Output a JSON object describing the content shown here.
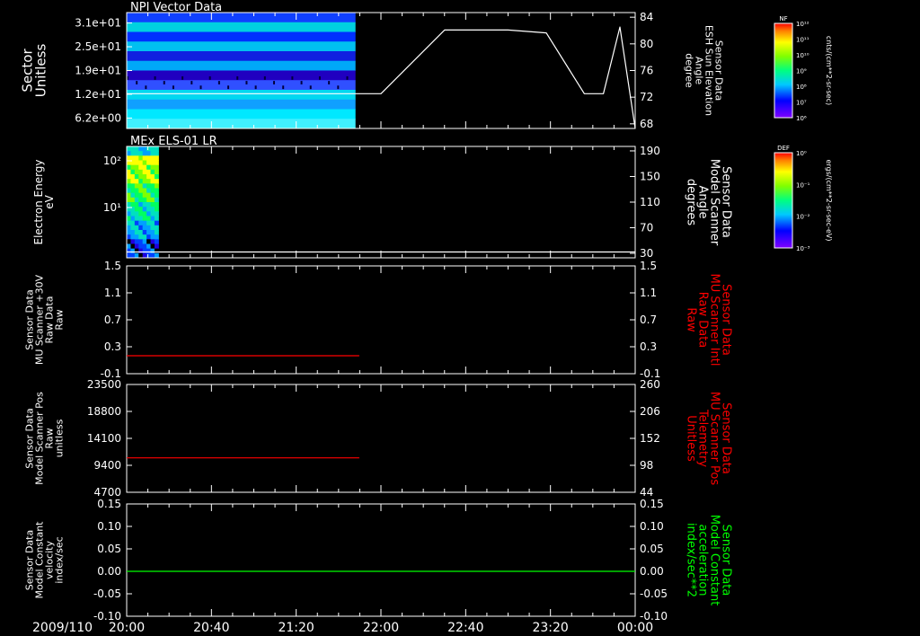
{
  "time_axis": {
    "date": "2009/110",
    "labels": [
      "20:00",
      "20:40",
      "21:20",
      "22:00",
      "22:40",
      "23:20",
      "00:00"
    ],
    "range_hours": [
      20,
      24
    ]
  },
  "colorbars": [
    {
      "title": "NF",
      "unit": "cnts/(cm**2-sr-sec)",
      "ticks": [
        "10¹²",
        "10¹¹",
        "10¹⁰",
        "10⁹",
        "10⁸",
        "10⁷",
        "10⁶"
      ]
    },
    {
      "title": "DEF",
      "unit": "ergs/(cm**2-sr-sec-eV)",
      "ticks": [
        "10⁰",
        "10⁻¹",
        "10⁻²",
        "10⁻³"
      ]
    }
  ],
  "panels": [
    {
      "title": "NPI Vector Data"
    },
    {
      "title": "MEx ELS-01 LR"
    },
    {
      "title": ""
    },
    {
      "title": ""
    },
    {
      "title": ""
    }
  ],
  "chart_data": [
    {
      "type": "heatmap",
      "title": "NPI Vector Data",
      "ylabel": [
        "Sector",
        "Unitless"
      ],
      "y_ticks": [
        "3.1e+01",
        "2.5e+01",
        "1.9e+01",
        "1.2e+01",
        "6.2e+00"
      ],
      "y2label": [
        "Sensor Data",
        "ESH Sun Elevation",
        "Angle",
        "degree"
      ],
      "y2_ticks": [
        "84",
        "80",
        "76",
        "72",
        "68"
      ],
      "y2lim": [
        64,
        84
      ],
      "data_time_range": [
        20.0,
        21.8
      ],
      "line": {
        "name": "ESH Sun Elevation Angle",
        "x": [
          20.0,
          21.7,
          22.0,
          22.5,
          23.0,
          23.3,
          23.6,
          23.75,
          23.88,
          24.0
        ],
        "y": [
          70,
          70,
          70,
          81,
          81,
          80.5,
          70,
          70,
          81.5,
          64
        ]
      }
    },
    {
      "type": "heatmap",
      "title": "MEx ELS-01 LR",
      "ylabel": [
        "Electron Energy",
        "eV"
      ],
      "y_ticks": [
        "10²",
        "10¹"
      ],
      "y2label": [
        "Sensor Data",
        "Model Scanner",
        "Angle",
        "degrees"
      ],
      "y2_ticks": [
        "190",
        "150",
        "110",
        "70",
        "30"
      ],
      "y2lim": [
        0,
        190
      ],
      "data_time_range": [
        20.0,
        20.25
      ],
      "line": {
        "name": "Model Scanner Angle",
        "x": [
          20.0,
          24.0
        ],
        "y": [
          10,
          10
        ]
      }
    },
    {
      "type": "line",
      "ylabel": [
        "Sensor Data",
        "MU Scanner +30V",
        "Raw Data",
        "Raw"
      ],
      "y_ticks": [
        "1.5",
        "1.1",
        "0.7",
        "0.3",
        "-0.1"
      ],
      "ylim": [
        -0.3,
        1.5
      ],
      "y2label": [
        "Sensor Data",
        "MU Scanner Intl",
        "Raw Data",
        "Raw"
      ],
      "y2_ticks": [
        "1.5",
        "1.1",
        "0.7",
        "0.3",
        "-0.1"
      ],
      "y2lim": [
        -0.3,
        1.5
      ],
      "series": [
        {
          "x": [
            20.0,
            21.83
          ],
          "y": [
            0.0,
            0.0
          ],
          "color": "#ff0000"
        }
      ]
    },
    {
      "type": "line",
      "ylabel": [
        "Sensor Data",
        "Model Scanner Pos",
        "Raw",
        "unitless"
      ],
      "y_ticks": [
        "23500",
        "18800",
        "14100",
        "9400",
        "4700"
      ],
      "ylim": [
        0,
        23500
      ],
      "y2label": [
        "Sensor Data",
        "MU Scanner Pos",
        "Telemetry",
        "Unitless"
      ],
      "y2_ticks": [
        "260",
        "206",
        "152",
        "98",
        "44"
      ],
      "y2lim": [
        0,
        260
      ],
      "series": [
        {
          "x": [
            20.0,
            21.83
          ],
          "y": [
            7500,
            7500
          ],
          "color": "#ff0000"
        }
      ]
    },
    {
      "type": "line",
      "ylabel": [
        "Sensor Data",
        "Model Constant",
        "velocity",
        "index/sec"
      ],
      "y_ticks": [
        "0.15",
        "0.10",
        "0.05",
        "0.00",
        "-0.05",
        "-0.10"
      ],
      "ylim": [
        -0.1,
        0.15
      ],
      "y2label": [
        "Sensor Data",
        "Model Constant",
        "acceleration",
        "index/sec**2"
      ],
      "y2_ticks": [
        "0.15",
        "0.10",
        "0.05",
        "0.00",
        "-0.05",
        "-0.10"
      ],
      "y2lim": [
        -0.1,
        0.15
      ],
      "series": [
        {
          "x": [
            20.0,
            24.0
          ],
          "y": [
            0.0,
            0.0
          ],
          "color": "#00ff00"
        }
      ]
    }
  ],
  "colors": {
    "axis": "#ffffff",
    "right_label_default": "#ffffff",
    "right_label_3": "#ff0000",
    "right_label_4": "#ff0000",
    "right_label_5": "#00ff00"
  }
}
